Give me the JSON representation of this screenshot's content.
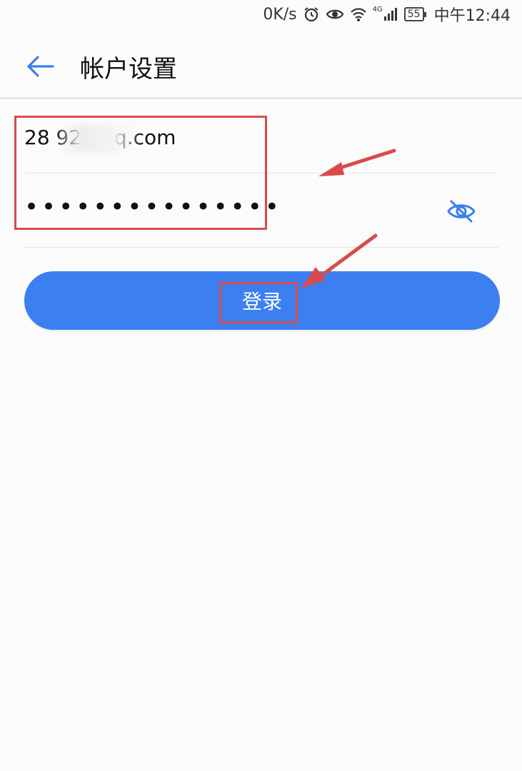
{
  "status_bar": {
    "network_speed": "0K/s",
    "signal_label": "4G",
    "battery": "55",
    "time": "中午12:44",
    "icons": [
      "alarm-icon",
      "eye-comfort-icon",
      "wifi-icon",
      "signal-icon",
      "battery-icon"
    ]
  },
  "header": {
    "title": "帐户设置",
    "back_icon": "arrow-left-icon"
  },
  "form": {
    "email_value": "28        92@qq.com",
    "password_value": "•••••••••••••••",
    "visibility_icon": "eye-off-icon"
  },
  "login_button": {
    "label": "登录"
  },
  "colors": {
    "accent": "#3b7ff0",
    "annotation": "#d94b4b",
    "background": "#fbfbfb"
  }
}
